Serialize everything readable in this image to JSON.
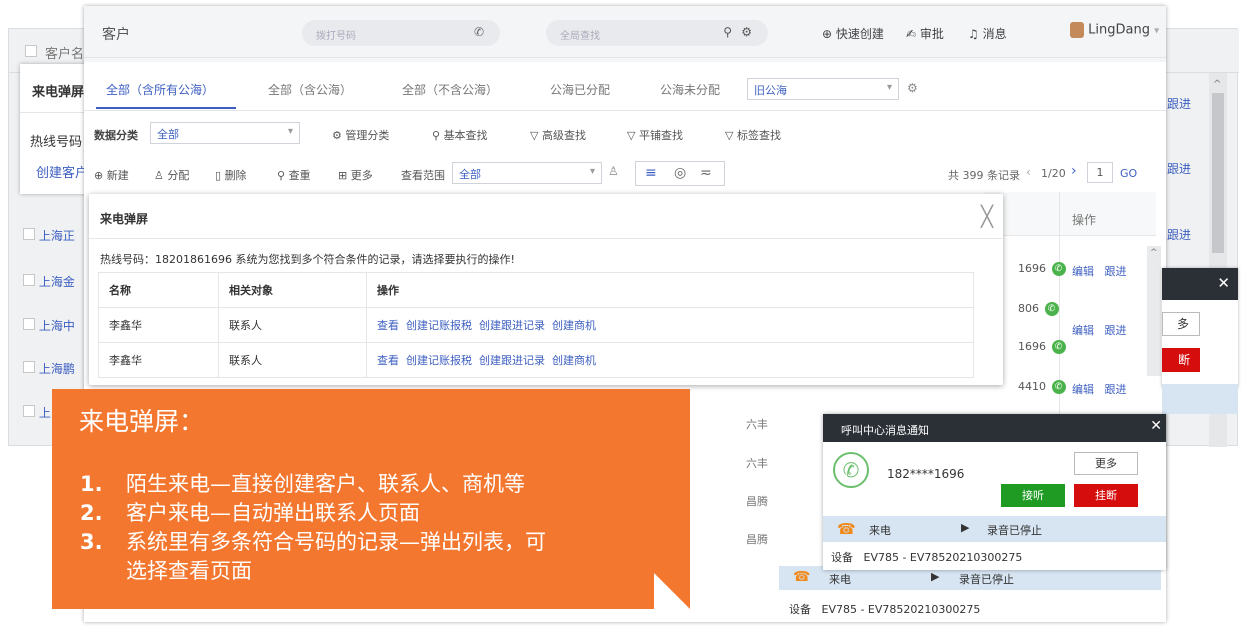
{
  "bg": {
    "header_label": "客户名",
    "popup_title": "来电弹屏",
    "popup_hotline": "热线号码",
    "popup_create": "创建客户",
    "rows": [
      "上海正",
      "上海金",
      "上海中",
      "上海鹏",
      "上"
    ],
    "right_links": [
      "跟进",
      "跟进",
      "跟进"
    ]
  },
  "topbar": {
    "title": "客户",
    "dial_placeholder": "拨打号码",
    "search_placeholder": "全局查找",
    "quick_create": "快速创建",
    "approval": "审批",
    "messages": "消息",
    "user": "LingDang"
  },
  "tabs": [
    "全部（含所有公海）",
    "全部（含公海）",
    "全部（不含公海）",
    "公海已分配",
    "公海未分配"
  ],
  "pool_select": "旧公海",
  "filter": {
    "label": "数据分类",
    "value": "全部",
    "manage": "管理分类",
    "basic": "基本查找",
    "advanced": "高级查找",
    "flat": "平铺查找",
    "tag": "标签查找"
  },
  "actions": {
    "new": "新建",
    "assign": "分配",
    "delete": "删除",
    "dedupe": "查重",
    "more": "更多",
    "scope_label": "查看范围",
    "scope_value": "全部"
  },
  "pager": {
    "total": "共 399 条记录",
    "page": "1/20",
    "input": "1",
    "go": "GO"
  },
  "table": {
    "op_header": "操作",
    "phones": [
      "1696",
      "806",
      "1696",
      "4410"
    ],
    "op_rows": [
      [
        "编辑",
        "跟进"
      ],
      [
        "编辑",
        "跟进"
      ],
      [
        "编辑",
        "跟进"
      ]
    ],
    "cities": [
      "六丰",
      "六丰",
      "昌腾",
      "昌腾"
    ]
  },
  "modal": {
    "title": "来电弹屏",
    "message": "热线号码：18201861696 系统为您找到多个符合条件的记录，请选择要执行的操作!",
    "headers": [
      "名称",
      "相关对象",
      "操作"
    ],
    "rows": [
      {
        "name": "李鑫华",
        "object": "联系人",
        "ops": [
          "查看",
          "创建记账报税",
          "创建跟进记录",
          "创建商机"
        ]
      },
      {
        "name": "李鑫华",
        "object": "联系人",
        "ops": [
          "查看",
          "创建记账报税",
          "创建跟进记录",
          "创建商机"
        ]
      }
    ]
  },
  "orange": {
    "title": "来电弹屏：",
    "items": [
      {
        "num": "1.",
        "text": "陌生来电—直接创建客户、联系人、商机等"
      },
      {
        "num": "2.",
        "text": "客户来电—自动弹出联系人页面"
      },
      {
        "num": "3.",
        "text": "系统里有多条符合号码的记录—弹出列表，可"
      },
      {
        "num": "",
        "text": "选择查看页面"
      }
    ]
  },
  "right_popup": {
    "more": "多",
    "hangup": "断"
  },
  "notification": {
    "title": "呼叫中心消息通知",
    "number": "182****1696",
    "more": "更多",
    "answer": "接听",
    "hangup": "挂断",
    "incoming": "来电",
    "recording": "录音已停止",
    "device_label": "设备",
    "device": "EV785 - EV78520210300275"
  },
  "notification2": {
    "incoming": "来电",
    "recording": "录音已停止",
    "device_label": "设备",
    "device": "EV785 - EV78520210300275"
  },
  "colors": {
    "accent": "#3d5fc1",
    "orange": "#f4772f",
    "notif_header": "#2b2f36",
    "answer": "#1f9b24",
    "hangup": "#d60d0d"
  }
}
